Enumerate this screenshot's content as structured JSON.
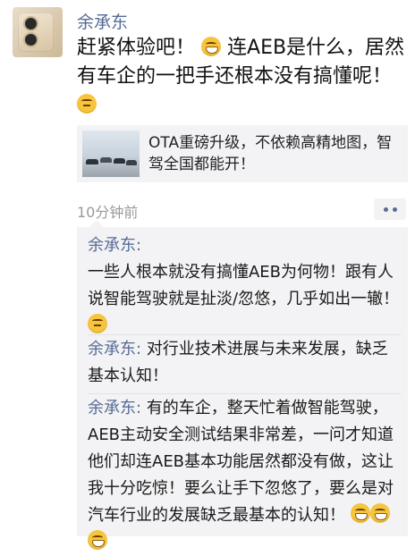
{
  "post": {
    "author": "余承东",
    "text_part1": "赶紧体验吧！",
    "text_part2": "连AEB是什么，居然有车企的一把手还根本没有搞懂呢！",
    "time": "10分钟前"
  },
  "link": {
    "title": "OTA重磅升级，不依赖高精地图，智驾全国都能开！"
  },
  "comments": [
    {
      "name": "余承东:",
      "text": "一些人根本就没有搞懂AEB为何物！跟有人说智能驾驶就是扯淡/忽悠，几乎如出一辙！"
    },
    {
      "name": "余承东:",
      "text": "对行业技术进展与未来发展，缺乏基本认知！"
    },
    {
      "name": "余承东:",
      "text": "有的车企，整天忙着做智能驾驶，AEB主动安全测试结果非常差，一问才知道他们却连AEB基本功能居然都没有做，这让我十分吃惊！要么让手下忽悠了，要么是对汽车行业的发展缺乏最基本的认知！"
    }
  ],
  "colors": {
    "name": "#576b95",
    "comment_bg": "#f3f3f5",
    "timestamp": "#9a9a9a"
  },
  "icons": {
    "grin": "grinning-face-icon",
    "think": "thinking-face-icon",
    "more": "more-dots-icon"
  }
}
